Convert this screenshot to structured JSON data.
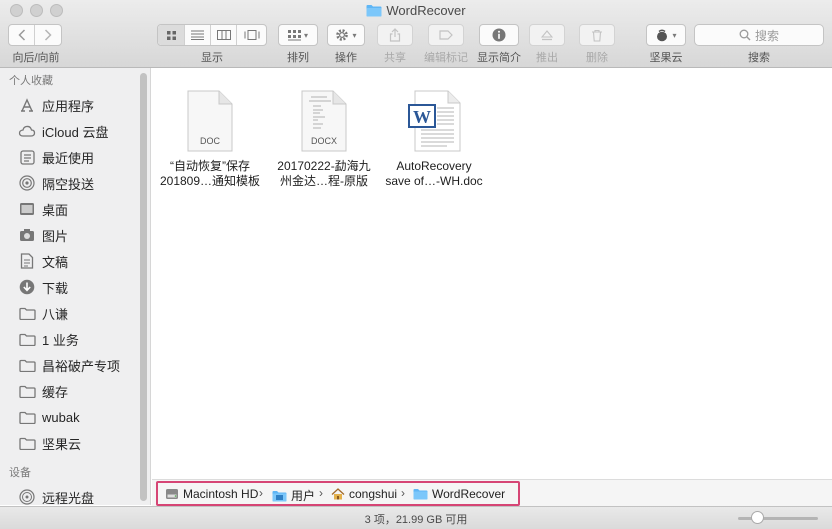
{
  "window": {
    "title": "WordRecover"
  },
  "toolbar": {
    "nav_label": "向后/向前",
    "view_label": "显示",
    "arrange_label": "排列",
    "action_label": "操作",
    "share_label": "共享",
    "tags_label": "编辑标记",
    "info_label": "显示简介",
    "eject_label": "推出",
    "delete_label": "删除",
    "jianguoyun_label": "坚果云",
    "search_placeholder": "搜索",
    "search_label": "搜索"
  },
  "sidebar": {
    "favorites_header": "个人收藏",
    "favorites": [
      {
        "label": "应用程序",
        "icon": "applications-icon"
      },
      {
        "label": "iCloud 云盘",
        "icon": "cloud-icon"
      },
      {
        "label": "最近使用",
        "icon": "recents-icon"
      },
      {
        "label": "隔空投送",
        "icon": "airdrop-icon"
      },
      {
        "label": "桌面",
        "icon": "desktop-icon"
      },
      {
        "label": "图片",
        "icon": "camera-icon"
      },
      {
        "label": "文稿",
        "icon": "documents-icon"
      },
      {
        "label": "下载",
        "icon": "download-icon"
      },
      {
        "label": "八谦",
        "icon": "folder-icon"
      },
      {
        "label": "1 业务",
        "icon": "folder-icon"
      },
      {
        "label": "昌裕破产专项",
        "icon": "folder-icon"
      },
      {
        "label": "缓存",
        "icon": "folder-icon"
      },
      {
        "label": "wubak",
        "icon": "folder-icon"
      },
      {
        "label": "坚果云",
        "icon": "folder-icon"
      }
    ],
    "devices_header": "设备",
    "devices": [
      {
        "label": "远程光盘",
        "icon": "disc-icon"
      }
    ]
  },
  "files": [
    {
      "line1": "“自动恢复”保存",
      "line2": "201809…通知模板",
      "badge": "DOC",
      "icon": "doc-file-icon"
    },
    {
      "line1": "20170222-勐海九",
      "line2": "州金达…程-原版",
      "badge": "DOCX",
      "icon": "docx-file-icon"
    },
    {
      "line1": "AutoRecovery",
      "line2": "save of…-WH.doc",
      "badge": "",
      "icon": "word-document-icon"
    }
  ],
  "pathbar": {
    "crumbs": [
      "Macintosh HD",
      "用户",
      "congshui",
      "WordRecover"
    ]
  },
  "status": {
    "text": "3 项，21.99 GB 可用"
  },
  "colors": {
    "accent_folder": "#5fb6f5",
    "highlight_border": "#d64575",
    "word_blue": "#2b5797"
  }
}
